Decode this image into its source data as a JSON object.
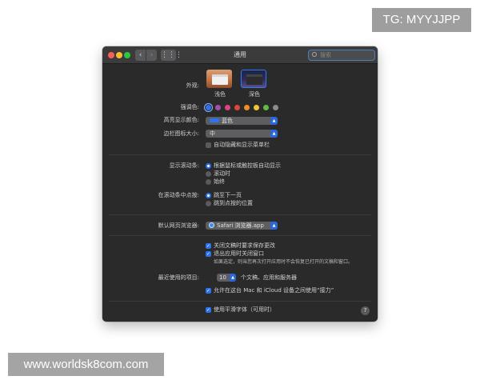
{
  "overlays": {
    "tg_badge": "TG: MYYJJPP",
    "site_badge": "www.worldsk8com.com"
  },
  "window": {
    "title": "通用",
    "search_placeholder": "搜索"
  },
  "appearance": {
    "label": "外观:",
    "options": [
      "浅色",
      "深色"
    ],
    "selected": "深色"
  },
  "accent": {
    "label": "强调色:",
    "colors": [
      "#2b73f0",
      "#a550a7",
      "#e0447f",
      "#e0443c",
      "#f08c2a",
      "#f0c43a",
      "#62ba46",
      "#8c8c8c"
    ],
    "selected_index": 0
  },
  "highlight": {
    "label": "高亮显示颜色:",
    "value": "蓝色"
  },
  "sidebar_icon": {
    "label": "边栏图标大小:",
    "value": "中"
  },
  "menubar": {
    "label": "自动隐藏和显示菜单栏"
  },
  "scrollbars": {
    "label": "显示滚动条:",
    "options": [
      "根据鼠标或触控板自动显示",
      "滚动时",
      "始终"
    ],
    "selected_index": 0
  },
  "scroll_click": {
    "label": "在滚动条中点按:",
    "options": [
      "跳至下一页",
      "跳到点按的位置"
    ],
    "selected_index": 0
  },
  "browser": {
    "label": "默认网页浏览器:",
    "value": "Safari 浏览器.app"
  },
  "documents": {
    "ask_keep_changes": "关闭文稿时要求保存更改",
    "close_windows": "退出应用时关闭窗口",
    "note": "如果选定，则当您再次打开应用时不会恢复已打开的文稿和窗口。"
  },
  "recent": {
    "label": "最近使用的项目:",
    "value": "10",
    "suffix": "个文稿、应用和服务器"
  },
  "handoff": {
    "label": "允许在这台 Mac 和 iCloud 设备之间使用“接力”"
  },
  "font_smoothing": {
    "label": "使用平滑字体（可用时）"
  },
  "help_label": "?"
}
